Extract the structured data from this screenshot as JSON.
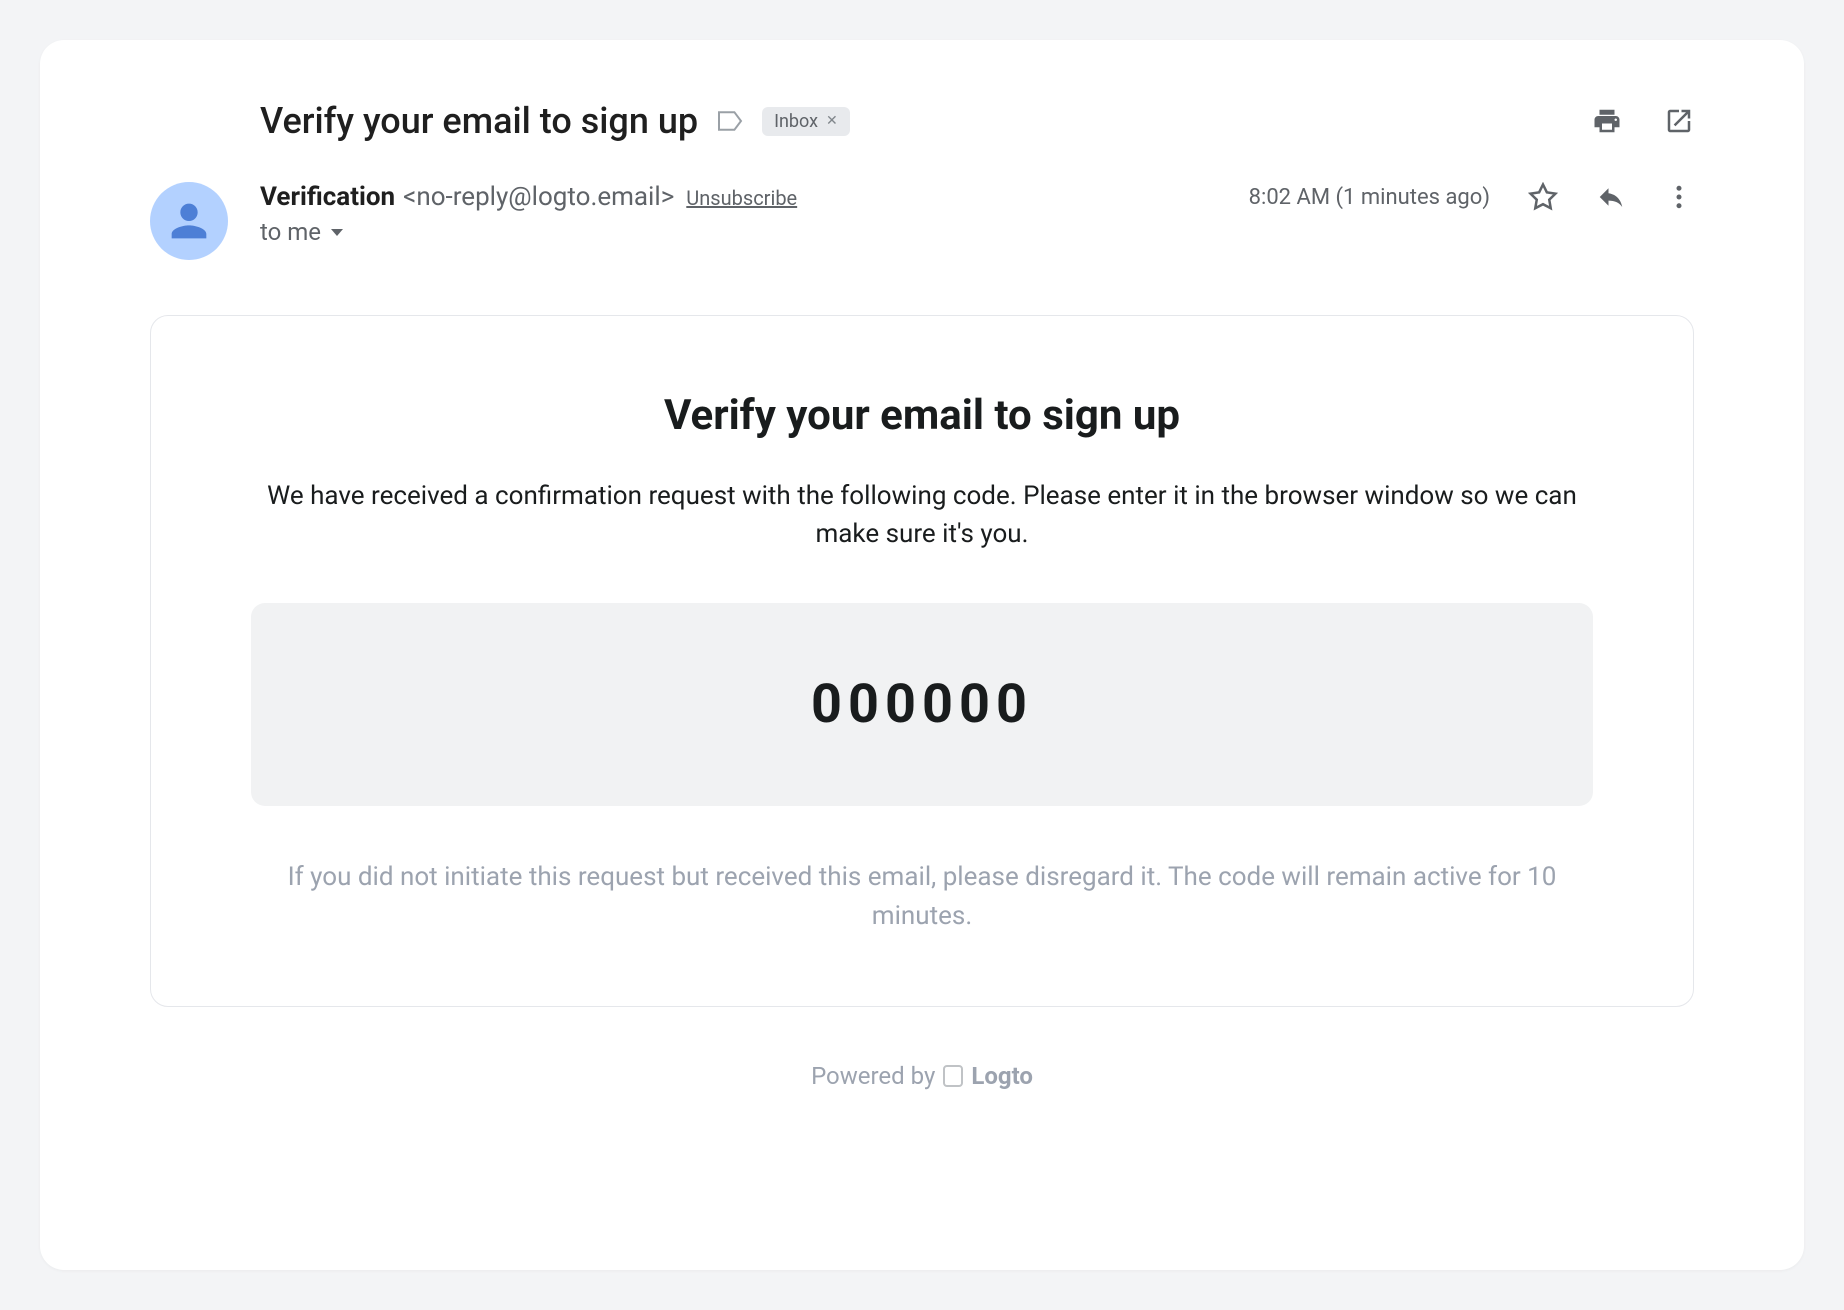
{
  "subject": {
    "title": "Verify your email to sign up",
    "tag": "Inbox"
  },
  "sender": {
    "name": "Verification",
    "email": "<no-reply@logto.email>",
    "unsubscribe": "Unsubscribe",
    "recipient": "to me"
  },
  "meta": {
    "timestamp": "8:02 AM (1 minutes ago)"
  },
  "body": {
    "title": "Verify your email to sign up",
    "description": "We have received a confirmation request with the following code. Please enter it in the browser window so we can make sure it's you.",
    "code": "000000",
    "disclaimer": "If you did not initiate this request but received this email, please disregard it. The code will remain active for 10 minutes."
  },
  "footer": {
    "powered_by": "Powered by",
    "brand": "Logto"
  }
}
